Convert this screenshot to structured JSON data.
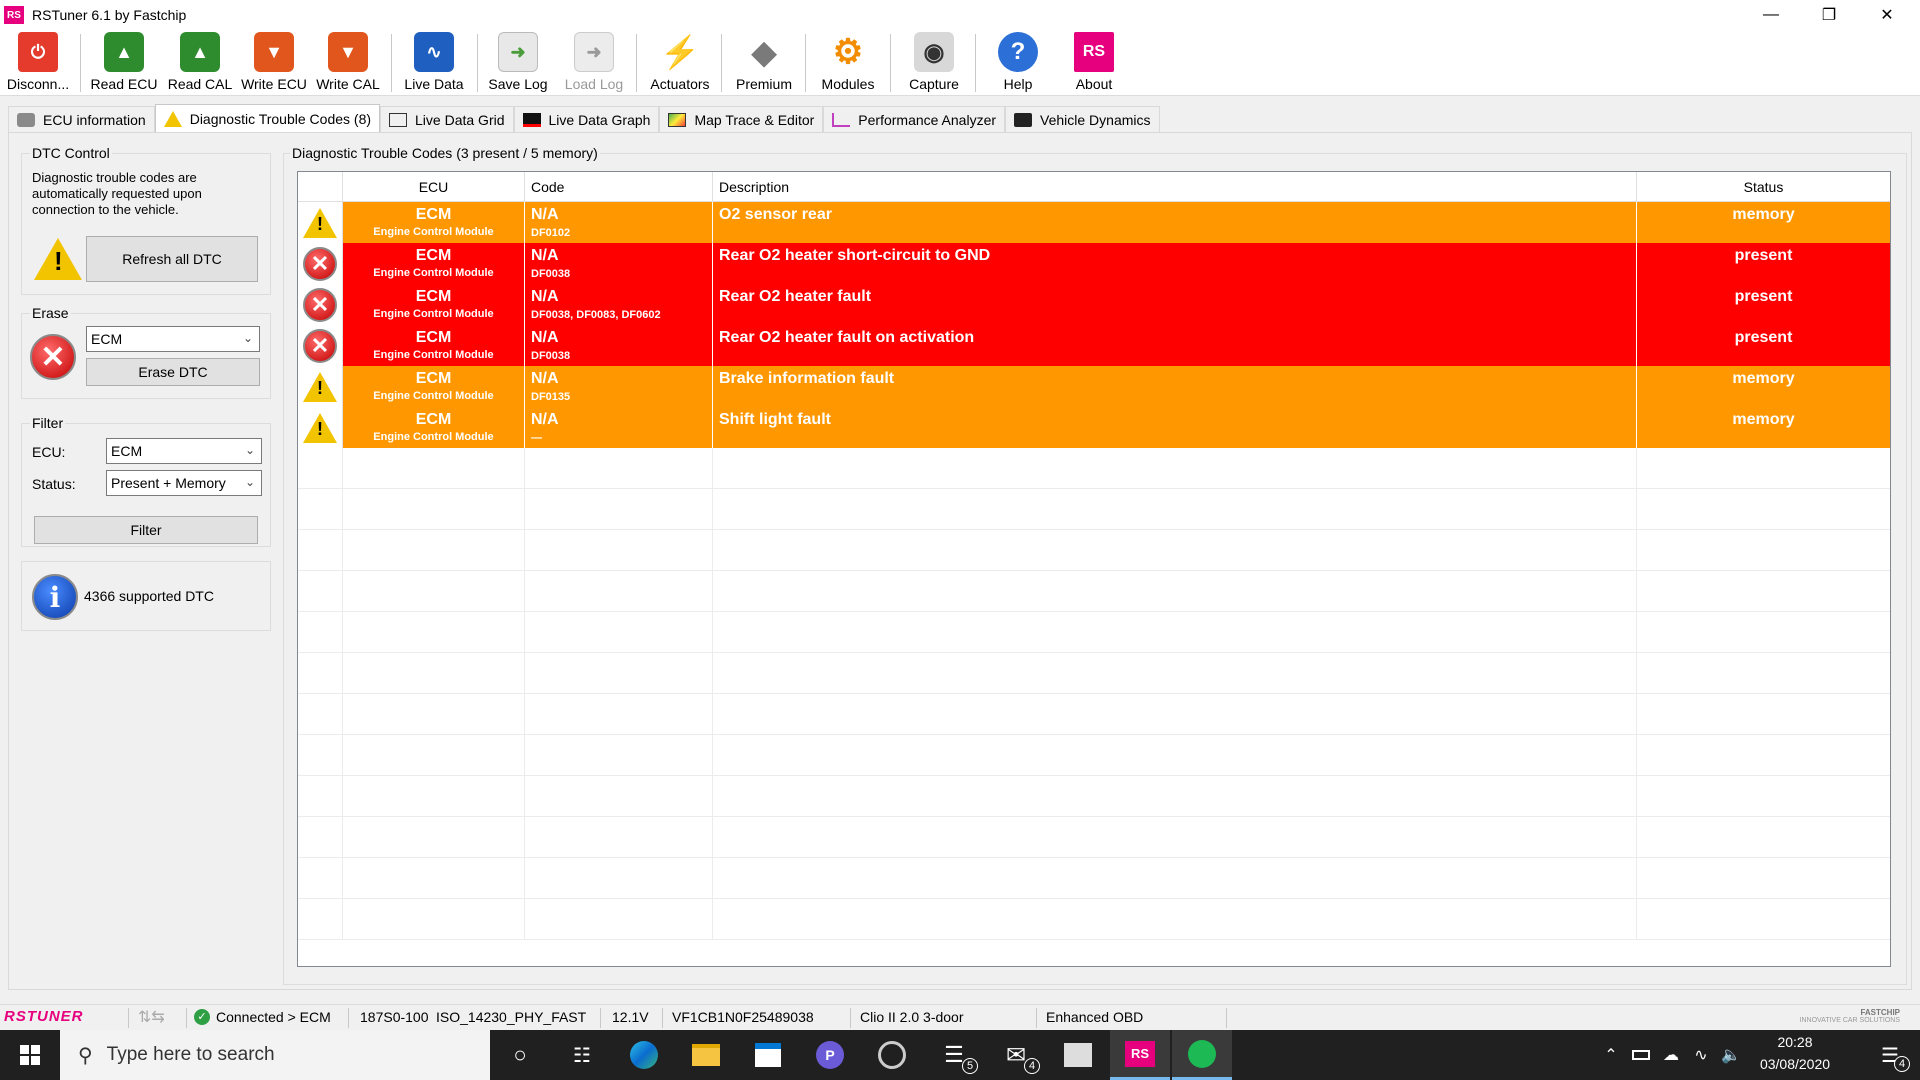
{
  "window": {
    "title": "RSTuner 6.1 by Fastchip",
    "app_icon": "RS"
  },
  "toolbar": [
    {
      "label": "Disconn...",
      "icon": "power-icon",
      "color": "#e53b2c"
    },
    {
      "label": "Read ECU",
      "icon": "read-ecu-icon",
      "color": "#2e8b2e"
    },
    {
      "label": "Read CAL",
      "icon": "read-cal-icon",
      "color": "#2e8b2e"
    },
    {
      "label": "Write ECU",
      "icon": "write-ecu-icon",
      "color": "#e0561c"
    },
    {
      "label": "Write CAL",
      "icon": "write-cal-icon",
      "color": "#e0561c"
    },
    {
      "label": "Live Data",
      "icon": "live-data-icon",
      "color": "#1e5fbf"
    },
    {
      "label": "Save Log",
      "icon": "save-log-icon",
      "color": "#4a9d3a"
    },
    {
      "label": "Load Log",
      "icon": "load-log-icon",
      "color": "#b0b0b0"
    },
    {
      "label": "Actuators",
      "icon": "lightning-icon",
      "color": "#e8b400"
    },
    {
      "label": "Premium",
      "icon": "renault-logo-icon",
      "color": "#7a7a7a"
    },
    {
      "label": "Modules",
      "icon": "modules-gear-icon",
      "color": "#f28c00"
    },
    {
      "label": "Capture",
      "icon": "camera-icon",
      "color": "#6a6a6a"
    },
    {
      "label": "Help",
      "icon": "help-icon",
      "color": "#2c6fd6"
    },
    {
      "label": "About",
      "icon": "rs-logo-icon",
      "color": "#e6007e"
    }
  ],
  "tabs": [
    {
      "label": "ECU information"
    },
    {
      "label": "Diagnostic Trouble Codes (8)"
    },
    {
      "label": "Live Data Grid"
    },
    {
      "label": "Live Data Graph"
    },
    {
      "label": "Map Trace & Editor"
    },
    {
      "label": "Performance Analyzer"
    },
    {
      "label": "Vehicle Dynamics"
    }
  ],
  "dtc_control": {
    "title": "DTC Control",
    "text": "Diagnostic trouble codes are automatically requested upon connection to the vehicle.",
    "refresh_label": "Refresh all DTC"
  },
  "erase": {
    "title": "Erase",
    "ecu_value": "ECM",
    "erase_label": "Erase DTC"
  },
  "filter": {
    "title": "Filter",
    "ecu_label": "ECU:",
    "ecu_value": "ECM",
    "status_label": "Status:",
    "status_value": "Present + Memory",
    "button_label": "Filter"
  },
  "supported": {
    "text": "4366 supported DTC"
  },
  "dtc_table": {
    "title": "Diagnostic Trouble Codes (3 present / 5 memory)",
    "columns": [
      "ECU",
      "Code",
      "Description",
      "Status"
    ],
    "rows": [
      {
        "ecu": "ECM",
        "ecu_sub": "Engine Control Module",
        "code": "N/A",
        "code_sub": "DF0102",
        "desc": "O2 sensor rear",
        "status": "memory"
      },
      {
        "ecu": "ECM",
        "ecu_sub": "Engine Control Module",
        "code": "N/A",
        "code_sub": "DF0038",
        "desc": "Rear O2 heater short-circuit to GND",
        "status": "present"
      },
      {
        "ecu": "ECM",
        "ecu_sub": "Engine Control Module",
        "code": "N/A",
        "code_sub": "DF0038, DF0083, DF0602",
        "desc": "Rear O2 heater fault",
        "status": "present"
      },
      {
        "ecu": "ECM",
        "ecu_sub": "Engine Control Module",
        "code": "N/A",
        "code_sub": "DF0038",
        "desc": "Rear O2 heater fault on activation",
        "status": "present"
      },
      {
        "ecu": "ECM",
        "ecu_sub": "Engine Control Module",
        "code": "N/A",
        "code_sub": "DF0135",
        "desc": "Brake information fault",
        "status": "memory"
      },
      {
        "ecu": "ECM",
        "ecu_sub": "Engine Control Module",
        "code": "N/A",
        "code_sub": "—",
        "desc": "Shift light fault",
        "status": "memory"
      }
    ],
    "colors": {
      "memory": "#ff9800",
      "present": "#ff0000"
    }
  },
  "statusbar": {
    "logo": "RSTUNER",
    "connection": "Connected > ECM",
    "ecu_id": "187S0-100",
    "protocol": "ISO_14230_PHY_FAST",
    "voltage": "12.1V",
    "vin": "VF1CB1N0F25489038",
    "vehicle": "Clio II 2.0 3-door",
    "mode": "Enhanced OBD",
    "brand_line1": "FASTCHIP",
    "brand_line2": "INNOVATIVE CAR SOLUTIONS"
  },
  "taskbar": {
    "search_placeholder": "Type here to search",
    "time": "20:28",
    "date": "03/08/2020",
    "badges": {
      "store": "5",
      "mail": "4",
      "notifications": "4"
    }
  }
}
